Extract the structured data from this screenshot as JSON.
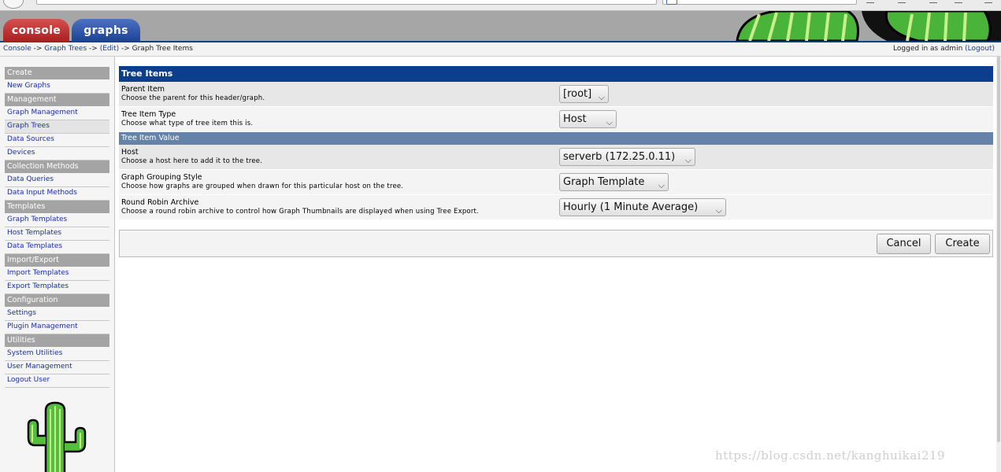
{
  "tabs": {
    "console": "console",
    "graphs": "graphs"
  },
  "breadcrumb": {
    "console": "Console",
    "sep1": " -> ",
    "graph_trees": "Graph Trees",
    "sep2": " -> ",
    "edit": "(Edit)",
    "sep3": " -> ",
    "current": "Graph Tree Items"
  },
  "login": {
    "prefix": "Logged in as admin",
    "logout": "(Logout)"
  },
  "sidebar": {
    "create_header": "Create",
    "new_graphs": "New Graphs",
    "management_header": "Management",
    "graph_management": "Graph Management",
    "graph_trees": "Graph Trees",
    "data_sources": "Data Sources",
    "devices": "Devices",
    "collection_header": "Collection Methods",
    "data_queries": "Data Queries",
    "data_input_methods": "Data Input Methods",
    "templates_header": "Templates",
    "graph_templates": "Graph Templates",
    "host_templates": "Host Templates",
    "data_templates": "Data Templates",
    "import_export_header": "Import/Export",
    "import_templates": "Import Templates",
    "export_templates": "Export Templates",
    "configuration_header": "Configuration",
    "settings": "Settings",
    "plugin_management": "Plugin Management",
    "utilities_header": "Utilities",
    "system_utilities": "System Utilities",
    "user_management": "User Management",
    "logout_user": "Logout User"
  },
  "form": {
    "title": "Tree Items",
    "parent_item": {
      "label": "Parent Item",
      "desc": "Choose the parent for this header/graph.",
      "value": "[root]"
    },
    "tree_item_type": {
      "label": "Tree Item Type",
      "desc": "Choose what type of tree item this is.",
      "value": "Host"
    },
    "value_header": "Tree Item Value",
    "host": {
      "label": "Host",
      "desc": "Choose a host here to add it to the tree.",
      "value": "serverb (172.25.0.11)"
    },
    "grouping": {
      "label": "Graph Grouping Style",
      "desc": "Choose how graphs are grouped when drawn for this particular host on the tree.",
      "value": "Graph Template"
    },
    "rra": {
      "label": "Round Robin Archive",
      "desc": "Choose a round robin archive to control how Graph Thumbnails are displayed when using Tree Export.",
      "value": "Hourly (1 Minute Average)"
    }
  },
  "buttons": {
    "cancel": "Cancel",
    "create": "Create"
  },
  "watermark": "https://blog.csdn.net/kanghuikai219",
  "icons": {
    "dropdown": "chevron-down-icon",
    "cactus": "cactus-logo"
  },
  "colors": {
    "title_bar": "#0c3e8e",
    "subheader": "#6583a8",
    "menu_header": "#a4a4a4",
    "link": "#1a2f9c",
    "console_tab": "#b82b2b",
    "graphs_tab": "#2a4da3"
  }
}
